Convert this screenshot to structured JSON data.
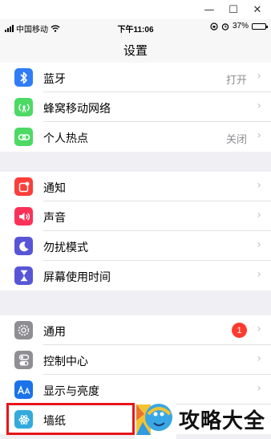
{
  "window": {
    "minimize_glyph": "—",
    "maximize_glyph": "☐",
    "close_glyph": "✕"
  },
  "status_bar": {
    "carrier": "中国移动",
    "time": "下午11:06",
    "battery": "37%"
  },
  "header": {
    "title": "设置"
  },
  "groups": [
    {
      "items": [
        {
          "label": "蓝牙",
          "value": "打开",
          "icon": "bluetooth-icon",
          "icon_color": "#2f7cf6"
        },
        {
          "label": "蜂窝移动网络",
          "value": "",
          "icon": "cellular-antenna-icon",
          "icon_color": "#4cd964"
        },
        {
          "label": "个人热点",
          "value": "关闭",
          "icon": "hotspot-link-icon",
          "icon_color": "#4cd964"
        }
      ]
    },
    {
      "items": [
        {
          "label": "通知",
          "value": "",
          "icon": "notifications-icon",
          "icon_color": "#fc3d39"
        },
        {
          "label": "声音",
          "value": "",
          "icon": "speaker-icon",
          "icon_color": "#fc3158"
        },
        {
          "label": "勿扰模式",
          "value": "",
          "icon": "moon-icon",
          "icon_color": "#5856d6"
        },
        {
          "label": "屏幕使用时间",
          "value": "",
          "icon": "hourglass-icon",
          "icon_color": "#5856d6"
        }
      ]
    },
    {
      "items": [
        {
          "label": "通用",
          "badge": "1",
          "icon": "gear-icon",
          "icon_color": "#8e8e93"
        },
        {
          "label": "控制中心",
          "value": "",
          "icon": "toggles-icon",
          "icon_color": "#8e8e93"
        },
        {
          "label": "显示与亮度",
          "value": "",
          "icon": "text-size-icon",
          "icon_color": "#1a73e8"
        },
        {
          "label": "墙纸",
          "value": "",
          "icon": "wallpaper-flower-icon",
          "icon_color": "#34aadc"
        }
      ]
    }
  ],
  "watermark": {
    "text": "攻略大全"
  }
}
